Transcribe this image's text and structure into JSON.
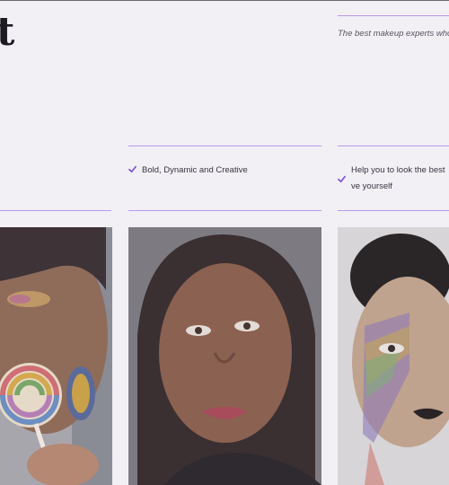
{
  "heading": {
    "partial": "t"
  },
  "tagline": "The best makeup experts who u",
  "features": [
    {
      "text": "Bold, Dynamic and Creative"
    },
    {
      "text": "Help you to look the best ve yourself"
    }
  ],
  "colors": {
    "accent": "#7a4fd6",
    "divider": "#b79be6",
    "background": "#f2eff5"
  },
  "icons": {
    "feature_marker": "check-icon"
  }
}
